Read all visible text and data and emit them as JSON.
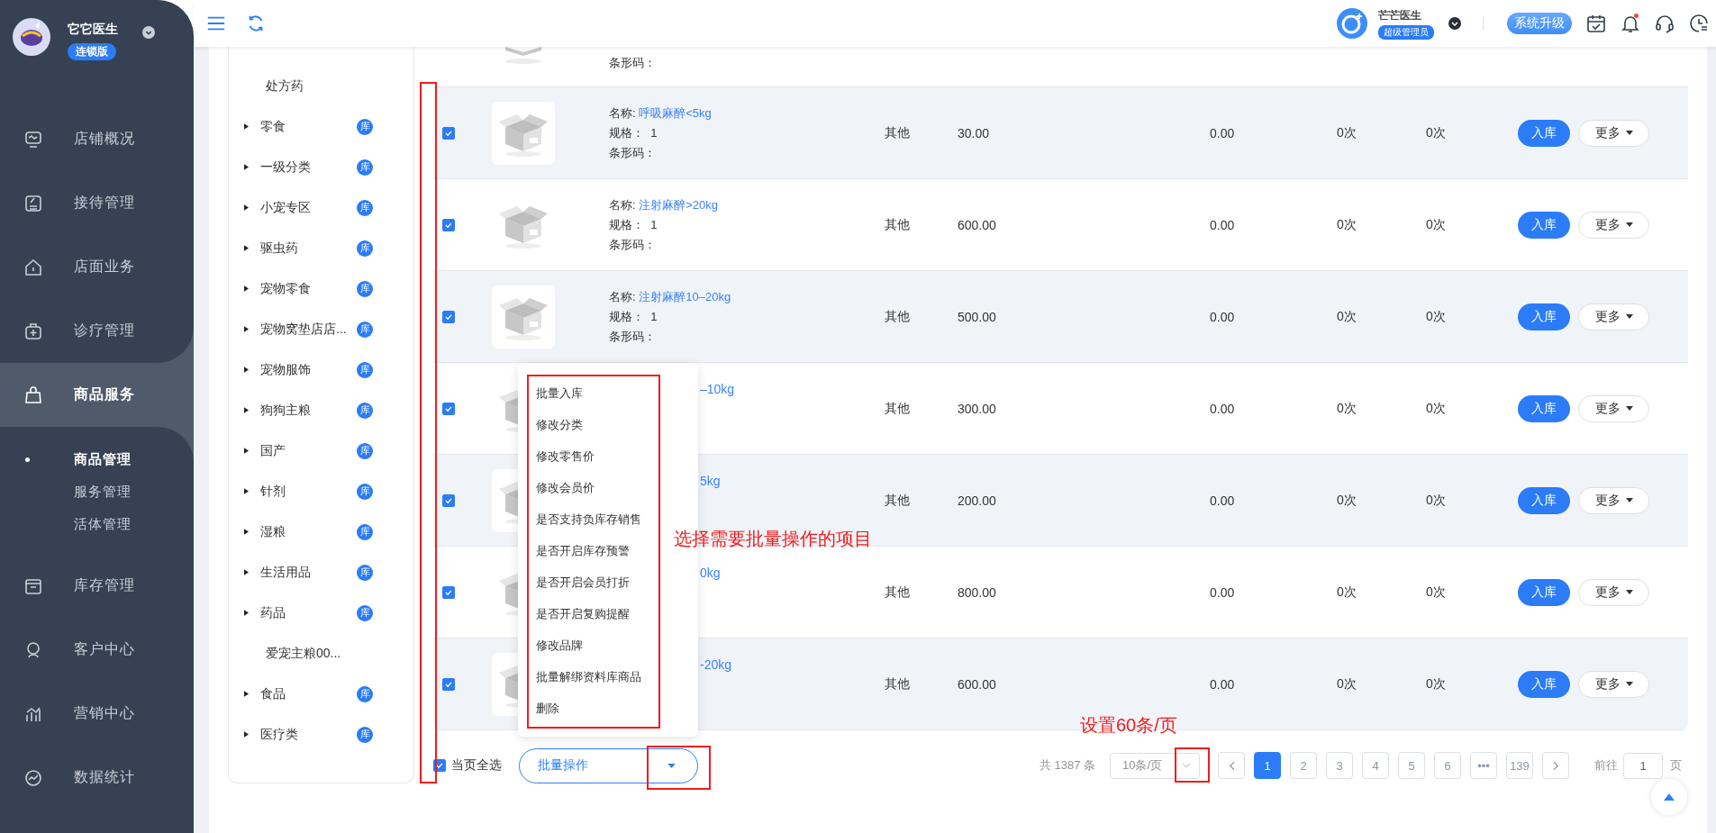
{
  "sidebar": {
    "brand": "它它医生",
    "edition": "连锁版",
    "menu": [
      {
        "label": "店铺概况",
        "selected": false
      },
      {
        "label": "接待管理",
        "selected": false
      },
      {
        "label": "店面业务",
        "selected": false
      },
      {
        "label": "诊疗管理",
        "selected": false
      },
      {
        "label": "商品服务",
        "selected": true,
        "children": [
          {
            "label": "商品管理",
            "selected": true
          },
          {
            "label": "服务管理",
            "selected": false
          },
          {
            "label": "活体管理",
            "selected": false
          }
        ]
      },
      {
        "label": "库存管理",
        "selected": false
      },
      {
        "label": "客户中心",
        "selected": false
      },
      {
        "label": "营销中心",
        "selected": false
      },
      {
        "label": "数据统计",
        "selected": false
      }
    ]
  },
  "header": {
    "user": {
      "name": "芒芒医生",
      "role": "超级管理员"
    },
    "upgrade_button": "系统升级",
    "notification_dot": true
  },
  "categories": [
    {
      "label": "处方药",
      "kind": "leaf"
    },
    {
      "label": "零食",
      "kind": "group",
      "badge": "库"
    },
    {
      "label": "一级分类",
      "kind": "group",
      "badge": "库"
    },
    {
      "label": "小宠专区",
      "kind": "group",
      "badge": "库"
    },
    {
      "label": "驱虫药",
      "kind": "group",
      "badge": "库"
    },
    {
      "label": "宠物零食",
      "kind": "group",
      "badge": "库"
    },
    {
      "label": "宠物窝垫店店...",
      "kind": "group",
      "badge": "库"
    },
    {
      "label": "宠物服饰",
      "kind": "group",
      "badge": "库"
    },
    {
      "label": "狗狗主粮",
      "kind": "group",
      "badge": "库"
    },
    {
      "label": "国产",
      "kind": "group",
      "badge": "库"
    },
    {
      "label": "针剂",
      "kind": "group",
      "badge": "库"
    },
    {
      "label": "湿粮",
      "kind": "group",
      "badge": "库"
    },
    {
      "label": "生活用品",
      "kind": "group",
      "badge": "库"
    },
    {
      "label": "药品",
      "kind": "group",
      "badge": "库"
    },
    {
      "label": "爱宠主粮00...",
      "kind": "leaf"
    },
    {
      "label": "食品",
      "kind": "group",
      "badge": "库"
    },
    {
      "label": "医疗类",
      "kind": "group",
      "badge": "库"
    }
  ],
  "table": {
    "rows": [
      {
        "kind": "partial",
        "barcode_label": "条形码："
      },
      {
        "kind": "full",
        "checked": true,
        "name_label": "名称:",
        "name": "呼吸麻醉<5kg",
        "spec_label": "规格：",
        "spec": "1",
        "barcode_label": "条形码：",
        "column_4": "其他",
        "column_5": "30.00",
        "column_6": "0.00",
        "column_7": "0次",
        "column_8": "0次",
        "stock_in": "入库",
        "more": "更多"
      },
      {
        "kind": "full",
        "checked": true,
        "name_label": "名称:",
        "name": "注射麻醉>20kg",
        "spec_label": "规格：",
        "spec": "1",
        "barcode_label": "条形码：",
        "column_4": "其他",
        "column_5": "600.00",
        "column_6": "0.00",
        "column_7": "0次",
        "column_8": "0次",
        "stock_in": "入库",
        "more": "更多"
      },
      {
        "kind": "full",
        "checked": true,
        "name_label": "名称:",
        "name": "注射麻醉10–20kg",
        "spec_label": "规格：",
        "spec": "1",
        "barcode_label": "条形码：",
        "column_4": "其他",
        "column_5": "500.00",
        "column_6": "0.00",
        "column_7": "0次",
        "column_8": "0次",
        "stock_in": "入库",
        "more": "更多"
      },
      {
        "kind": "covered",
        "checked": true,
        "name": "–10kg",
        "column_4": "其他",
        "column_5": "300.00",
        "column_6": "0.00",
        "column_7": "0次",
        "column_8": "0次",
        "stock_in": "入库",
        "more": "更多"
      },
      {
        "kind": "covered",
        "checked": true,
        "name": "5kg",
        "column_4": "其他",
        "column_5": "200.00",
        "column_6": "0.00",
        "column_7": "0次",
        "column_8": "0次",
        "stock_in": "入库",
        "more": "更多"
      },
      {
        "kind": "covered",
        "checked": true,
        "name": "0kg",
        "column_4": "其他",
        "column_5": "800.00",
        "column_6": "0.00",
        "column_7": "0次",
        "column_8": "0次",
        "stock_in": "入库",
        "more": "更多"
      },
      {
        "kind": "covered",
        "checked": true,
        "name": "-20kg",
        "column_4": "其他",
        "column_5": "600.00",
        "column_6": "0.00",
        "column_7": "0次",
        "column_8": "0次",
        "stock_in": "入库",
        "more": "更多"
      }
    ]
  },
  "footer": {
    "select_all": {
      "label": "当页全选",
      "checked": true
    },
    "batch_select": {
      "value": "批量操作",
      "open": true
    },
    "batch_menu": [
      "批量入库",
      "修改分类",
      "修改零售价",
      "修改会员价",
      "是否支持负库存销售",
      "是否开启库存预警",
      "是否开启会员打折",
      "是否开启复购提醒",
      "修改品牌",
      "批量解绑资料库商品",
      "删除"
    ]
  },
  "pagination": {
    "total": "共 1387 条",
    "page_size": "10条/页",
    "pages": [
      {
        "label": "1",
        "selected": true
      },
      {
        "label": "2",
        "selected": false
      },
      {
        "label": "3",
        "selected": false
      },
      {
        "label": "4",
        "selected": false
      },
      {
        "label": "5",
        "selected": false
      },
      {
        "label": "6",
        "selected": false
      },
      {
        "label": "•••",
        "selected": false
      },
      {
        "label": "139",
        "selected": false
      }
    ],
    "jump_label": "前往",
    "jump_value": "1",
    "jump_unit": "页"
  },
  "annotations": [
    "选择需要批量操作的项目",
    "设置60条/页"
  ]
}
